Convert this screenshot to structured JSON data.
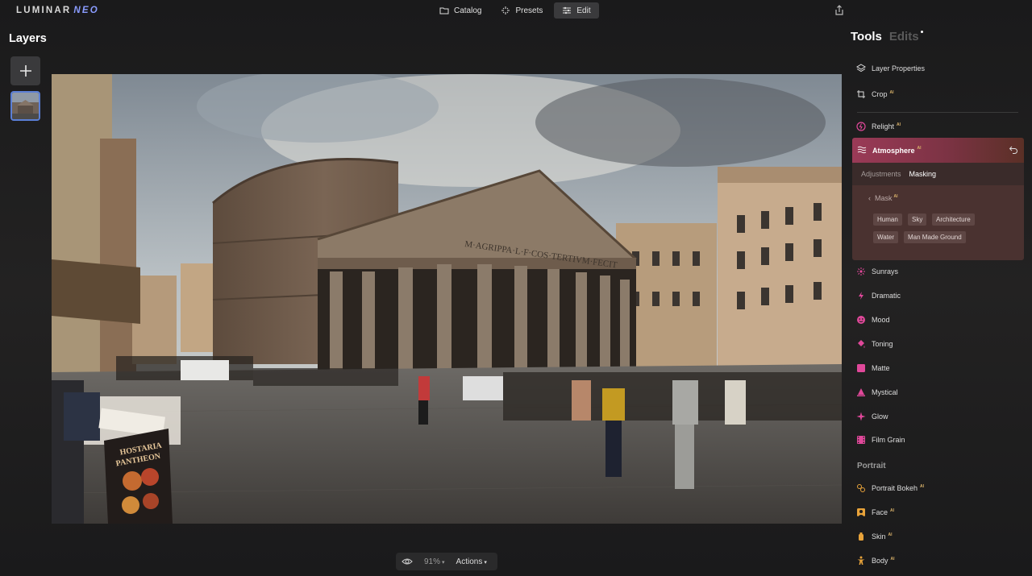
{
  "app": {
    "logo_main": "LUMINAR",
    "logo_accent": "NEO"
  },
  "topbar": {
    "modes": [
      {
        "label": "Catalog",
        "icon": "folder-icon"
      },
      {
        "label": "Presets",
        "icon": "sparkle-icon"
      },
      {
        "label": "Edit",
        "icon": "sliders-icon",
        "active": true
      }
    ],
    "share_icon": "share-icon"
  },
  "layers": {
    "title": "Layers",
    "add_icon": "plus-icon"
  },
  "bottom": {
    "zoom": "91%",
    "actions": "Actions"
  },
  "panel": {
    "tab_tools": "Tools",
    "tab_edits": "Edits",
    "tools_top": [
      {
        "label": "Layer Properties",
        "icon": "layers-icon",
        "ai": false
      },
      {
        "label": "Crop",
        "icon": "crop-icon",
        "ai": true
      },
      {
        "label": "Relight",
        "icon": "relight-icon",
        "ai": true
      }
    ],
    "atmosphere": {
      "label": "Atmosphere",
      "ai": true,
      "subtab_adjustments": "Adjustments",
      "subtab_masking": "Masking",
      "mask_label": "Mask",
      "mask_chips": [
        "Human",
        "Sky",
        "Architecture",
        "Water",
        "Man Made Ground"
      ]
    },
    "tools_bottom": [
      {
        "label": "Sunrays",
        "icon": "sunrays-icon",
        "ai": false
      },
      {
        "label": "Dramatic",
        "icon": "dramatic-icon",
        "ai": false
      },
      {
        "label": "Mood",
        "icon": "mood-icon",
        "ai": false
      },
      {
        "label": "Toning",
        "icon": "toning-icon",
        "ai": false
      },
      {
        "label": "Matte",
        "icon": "matte-icon",
        "ai": false
      },
      {
        "label": "Mystical",
        "icon": "mystical-icon",
        "ai": false
      },
      {
        "label": "Glow",
        "icon": "glow-icon",
        "ai": false
      },
      {
        "label": "Film Grain",
        "icon": "film-grain-icon",
        "ai": false
      }
    ],
    "section_portrait": "Portrait",
    "tools_portrait": [
      {
        "label": "Portrait Bokeh",
        "icon": "bokeh-icon",
        "ai": true
      },
      {
        "label": "Face",
        "icon": "face-icon",
        "ai": true
      },
      {
        "label": "Skin",
        "icon": "skin-icon",
        "ai": true
      },
      {
        "label": "Body",
        "icon": "body-icon",
        "ai": true
      }
    ],
    "ai_badge": "AI"
  },
  "photo": {
    "inscription": "M·AGRIPPA·L·F·COS·TERTIVM·FECIT",
    "sign_line1": "HOSTARIA",
    "sign_line2": "PANTHEON"
  },
  "colors": {
    "accent_blue": "#5b7fd6",
    "creative_pink": "#e0489a",
    "ai_gold": "#d9b26a"
  }
}
